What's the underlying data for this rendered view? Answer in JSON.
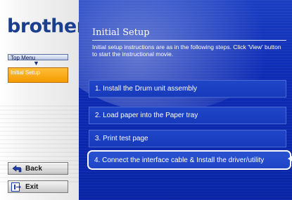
{
  "brand": {
    "logo_text": "brother."
  },
  "sidebar": {
    "top_menu_label": "Top Menu",
    "current_label": "Initial Setup",
    "back_label": "Back",
    "exit_label": "Exit"
  },
  "main": {
    "title": "Initial Setup",
    "description": "Initial setup instructions are as in the following steps. Click 'View' button to start the instructional movie.",
    "steps": [
      {
        "label": "1. Install the Drum unit assembly"
      },
      {
        "label": "2. Load paper into the Paper tray"
      },
      {
        "label": "3. Print test page"
      },
      {
        "label": "4. Connect the interface cable & Install the driver/utility"
      }
    ]
  },
  "colors": {
    "brand_blue": "#1b3f8f",
    "panel_blue": "#0c2ab4",
    "highlight_orange": "#f49b00"
  }
}
